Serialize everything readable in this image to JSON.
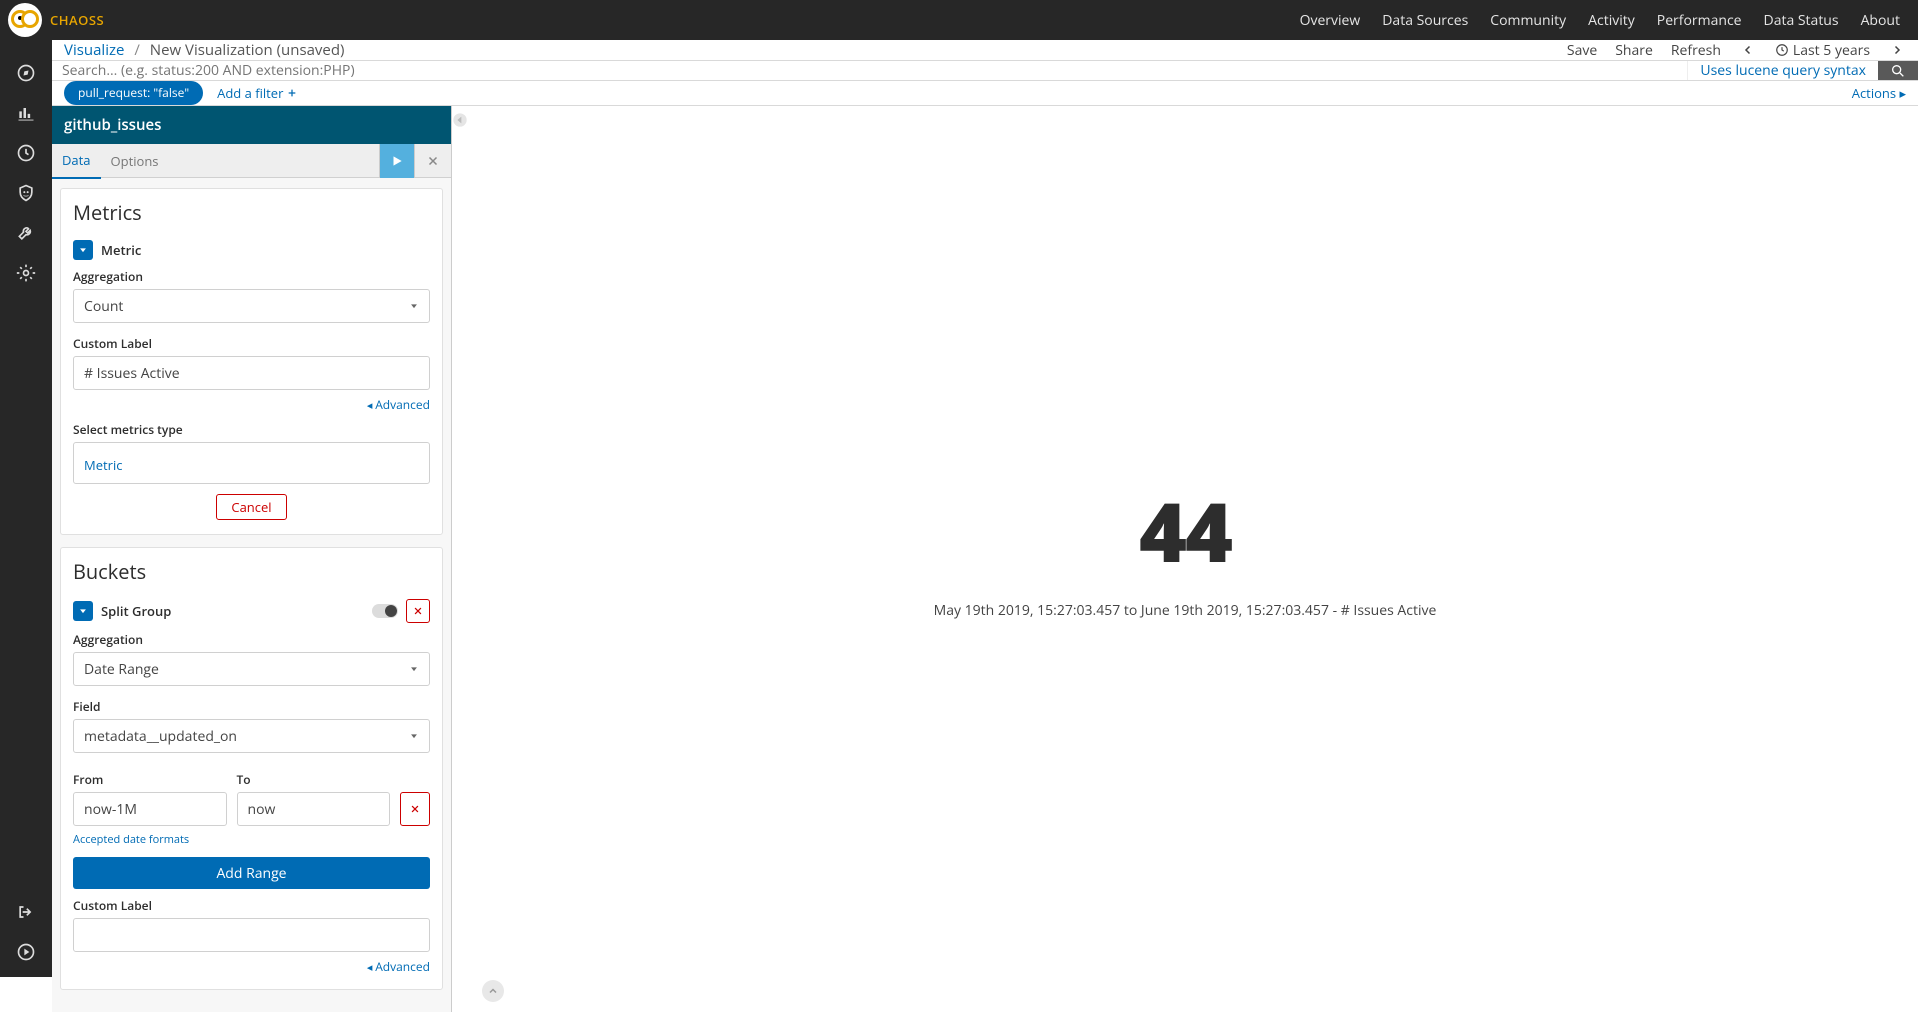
{
  "brand": "CHAOSS",
  "topnav": [
    "Overview",
    "Data Sources",
    "Community",
    "Activity",
    "Performance",
    "Data Status",
    "About"
  ],
  "crumbs": {
    "root": "Visualize",
    "current": "New Visualization (unsaved)"
  },
  "topactions": {
    "save": "Save",
    "share": "Share",
    "refresh": "Refresh",
    "timerange": "Last 5 years"
  },
  "search": {
    "placeholder": "Search... (e.g. status:200 AND extension:PHP)",
    "hint": "Uses lucene query syntax"
  },
  "filterpill": "pull_request: \"false\"",
  "addfilter": "Add a filter",
  "actionslink": "Actions",
  "index": "github_issues",
  "tabs": {
    "data": "Data",
    "options": "Options"
  },
  "metrics": {
    "title": "Metrics",
    "metric_label": "Metric",
    "agg_label": "Aggregation",
    "agg_value": "Count",
    "custom_label": "Custom Label",
    "custom_value": "# Issues Active",
    "advanced": "Advanced",
    "select_type": "Select metrics type",
    "metric_link": "Metric",
    "cancel": "Cancel"
  },
  "buckets": {
    "title": "Buckets",
    "split_label": "Split Group",
    "agg_label": "Aggregation",
    "agg_value": "Date Range",
    "field_label": "Field",
    "field_value": "metadata__updated_on",
    "from_label": "From",
    "from_value": "now-1M",
    "to_label": "To",
    "to_value": "now",
    "accepted": "Accepted date formats",
    "addrange": "Add Range",
    "custom_label": "Custom Label",
    "advanced": "Advanced"
  },
  "viz": {
    "value": "44",
    "caption": "May 19th 2019, 15:27:03.457 to June 19th 2019, 15:27:03.457 - # Issues Active"
  }
}
